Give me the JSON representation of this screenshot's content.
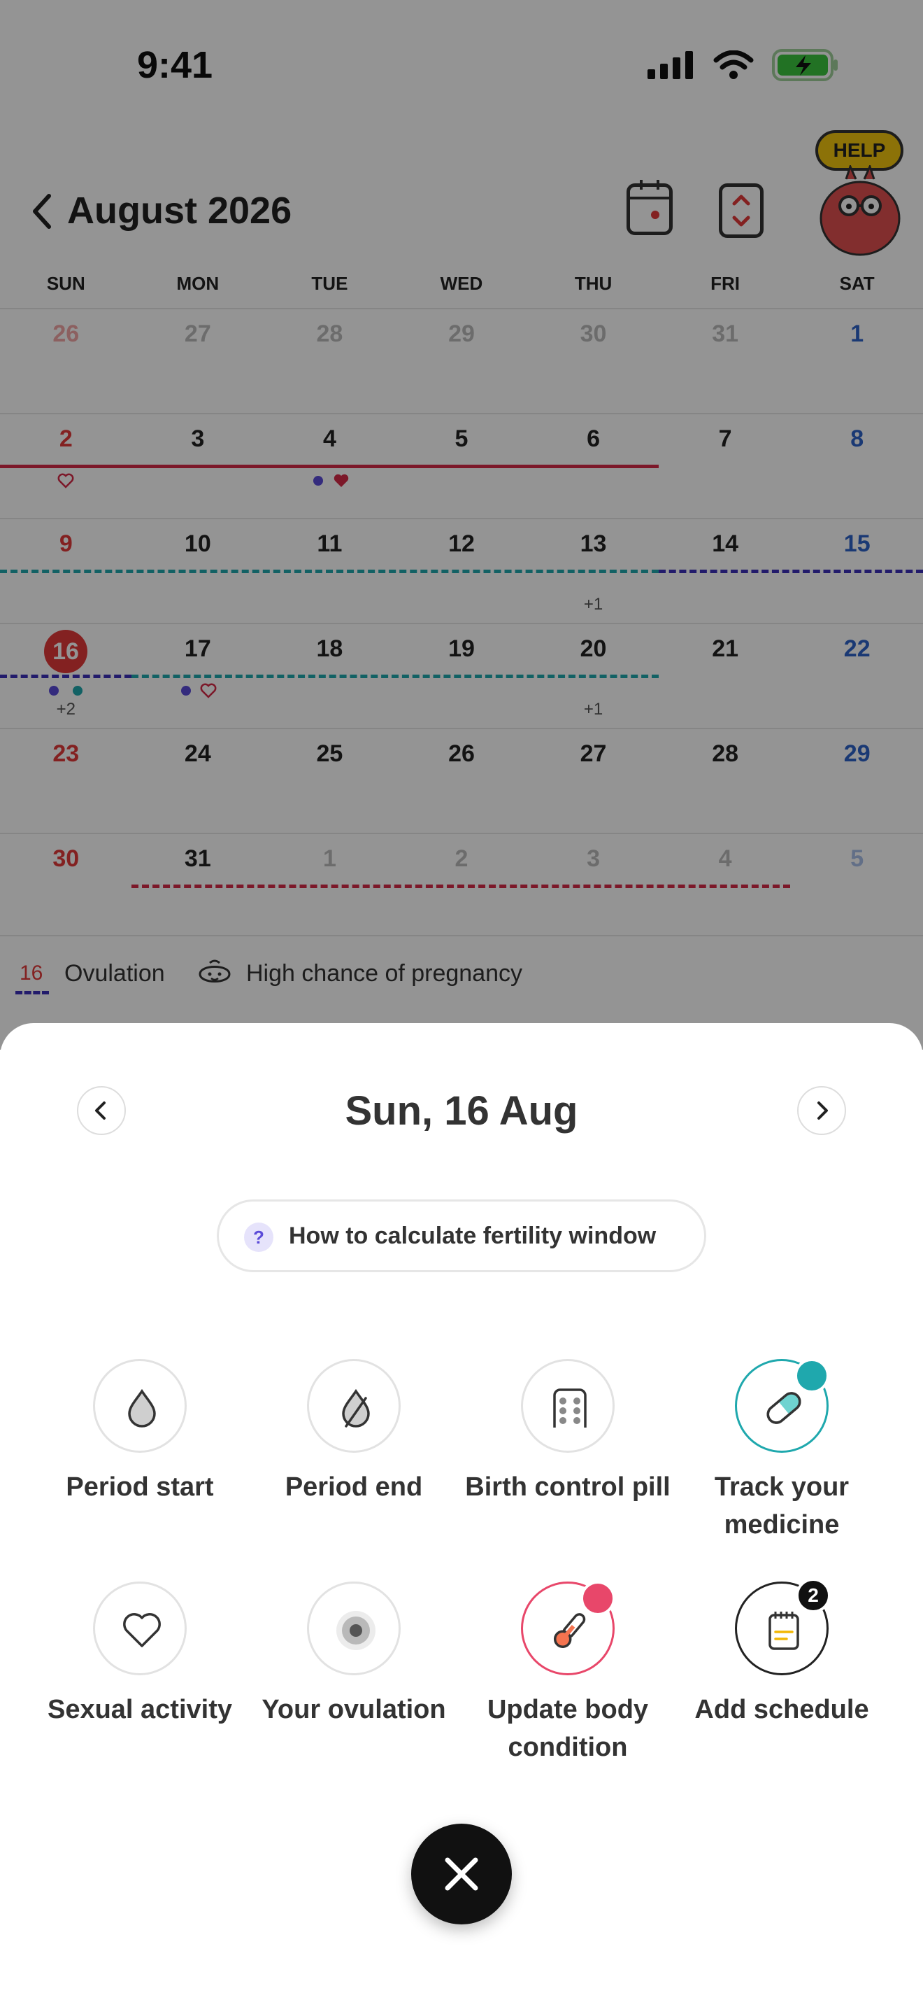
{
  "status_bar": {
    "time": "9:41"
  },
  "header": {
    "month_title": "August 2026",
    "help_label": "HELP"
  },
  "weekdays": [
    "SUN",
    "MON",
    "TUE",
    "WED",
    "THU",
    "FRI",
    "SAT"
  ],
  "calendar": {
    "weeks": [
      [
        "26",
        "27",
        "28",
        "29",
        "30",
        "31",
        "1"
      ],
      [
        "2",
        "3",
        "4",
        "5",
        "6",
        "7",
        "8"
      ],
      [
        "9",
        "10",
        "11",
        "12",
        "13",
        "14",
        "15"
      ],
      [
        "16",
        "17",
        "18",
        "19",
        "20",
        "21",
        "22"
      ],
      [
        "23",
        "24",
        "25",
        "26",
        "27",
        "28",
        "29"
      ],
      [
        "30",
        "31",
        "1",
        "2",
        "3",
        "4",
        "5"
      ]
    ],
    "today": "16",
    "extra_counts": {
      "thu_13": "+1",
      "sun_16": "+2",
      "thu_20": "+1"
    }
  },
  "legend": {
    "ovulation_day": "16",
    "ovulation_label": "Ovulation",
    "pregnancy_label": "High chance of pregnancy"
  },
  "sheet": {
    "date": "Sun, 16 Aug",
    "fertility_help": "How to calculate fertility window",
    "help_icon_glyph": "?",
    "options": [
      {
        "label": "Period start",
        "icon": "drop-icon"
      },
      {
        "label": "Period end",
        "icon": "drop-slash-icon"
      },
      {
        "label": "Birth control pill",
        "icon": "pill-pack-icon"
      },
      {
        "label": "Track your medicine",
        "icon": "capsule-icon",
        "checked": true
      },
      {
        "label": "Sexual activity",
        "icon": "heart-icon"
      },
      {
        "label": "Your ovulation",
        "icon": "ovulation-icon"
      },
      {
        "label": "Update body condition",
        "icon": "thermometer-icon",
        "checked": true
      },
      {
        "label": "Add schedule",
        "icon": "notepad-icon",
        "badge": "2"
      }
    ]
  },
  "colors": {
    "accent_red": "#e23a3a",
    "teal": "#1fa8ad",
    "purple": "#3b2fb8",
    "pink": "#e8476a"
  }
}
